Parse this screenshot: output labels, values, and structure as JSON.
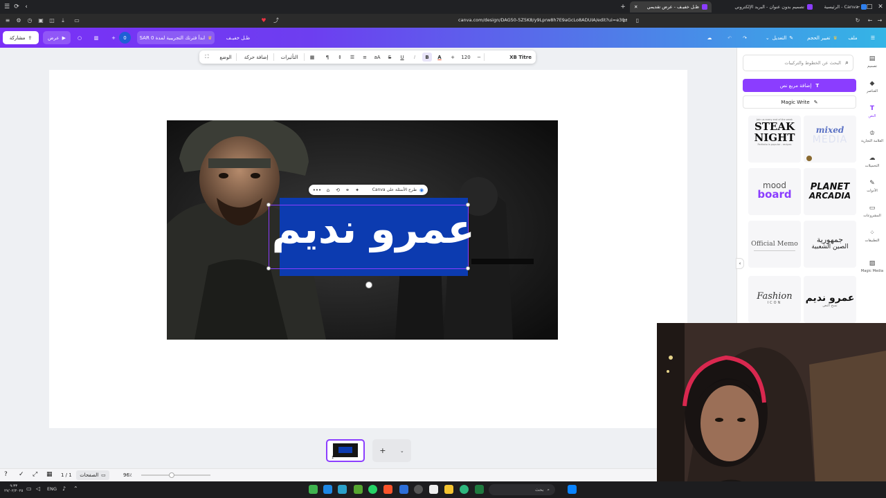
{
  "browser": {
    "tabs": [
      {
        "title": "Canva - الرئيسية",
        "color": "#2f80ed"
      },
      {
        "title": "تصميم بدون عنوان - البريد الإلكتروني",
        "color": "#8b3dff"
      },
      {
        "title": "ظـل خفيـف - عرض تقديمي",
        "color": "#8b3dff"
      }
    ],
    "url": "canva.com/design/DAG50-5Z5K8/y9Lprw8h7E9aGcLo8ADUIA/edit?ui=e30"
  },
  "header": {
    "share_label": "مشاركة",
    "present_label": "عرض",
    "count_label": "0",
    "trial_label": "ابدأ فترتك التجريبية لمدة SAR 0",
    "design_title": "ظـل خفيـف",
    "resize_label": "تغيير الحجم",
    "edit_label": "التعديل",
    "file_label": "ملف"
  },
  "toolbar": {
    "position_label": "الوضع",
    "animate_label": "إضافة حركة",
    "effects_label": "التأثيرات",
    "font_size": "120",
    "font_name": "XB Titre",
    "aa_label": "aA"
  },
  "canvas": {
    "heading_text": "عمرو نديم",
    "ask_canva_label": "طرح الأسئلة على Canva"
  },
  "panel": {
    "search_placeholder": "البحث عن الخطوط والتركيبات",
    "add_textbox_label": "إضافة مربع نص",
    "magic_write_label": "Magic Write",
    "cards": [
      {
        "line1": "STEAK",
        "line2": "NIGHT",
        "caption": "Join us every end of the week",
        "sub": "Perfecto is popular - recipes"
      },
      {
        "line1": "mixed",
        "line2": "MEDIA"
      },
      {
        "line1": "mood",
        "line2": "board"
      },
      {
        "line1": "PLANET",
        "line2": "ARCADIA"
      },
      {
        "line1": "Official Memo",
        "line2": ""
      },
      {
        "line1": "جمهورية",
        "line2": "الصين الشعبية"
      },
      {
        "line1": "Fashion",
        "line2": "ICON"
      },
      {
        "line1": "عمرو نديم",
        "line2": "نسخ النص"
      }
    ]
  },
  "rail": [
    {
      "label": "تصميم",
      "icon": "template-icon"
    },
    {
      "label": "العناصر",
      "icon": "elements-icon"
    },
    {
      "label": "النص",
      "icon": "text-icon"
    },
    {
      "label": "العلامة التجارية",
      "icon": "brand-icon"
    },
    {
      "label": "التحميلات",
      "icon": "upload-icon"
    },
    {
      "label": "الأدوات",
      "icon": "tools-icon"
    },
    {
      "label": "المشروعات",
      "icon": "projects-icon"
    },
    {
      "label": "التطبيقات",
      "icon": "apps-icon"
    },
    {
      "label": "Magic Media",
      "icon": "magic-media-icon"
    }
  ],
  "bottom": {
    "pages_label": "الصفحات",
    "page_counter": "1 / 1",
    "zoom": "96٪",
    "thumb_label": "1"
  },
  "taskbar": {
    "lang": "ENG",
    "search_label": "بحث",
    "time": "٩:٣٣",
    "date": "٢٧/٠٢/٢٠٢٥"
  },
  "colors": {
    "accent": "#8b3dff",
    "textbox": "#0c3bb0"
  }
}
